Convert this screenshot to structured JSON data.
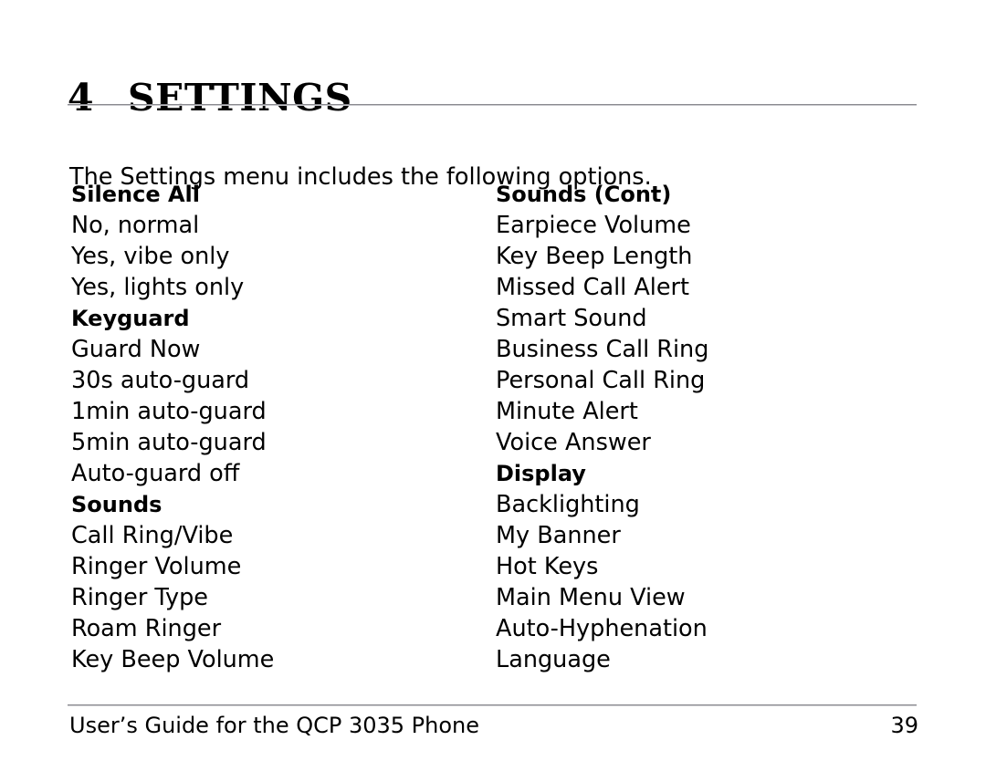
{
  "document": {
    "chapter_number": "4",
    "chapter_title": "SETTINGS",
    "intro": "The Settings menu includes the following options."
  },
  "columns": {
    "left": [
      {
        "text": "Silence All",
        "style": "heading"
      },
      {
        "text": "No, normal",
        "style": "item"
      },
      {
        "text": "Yes, vibe only",
        "style": "item"
      },
      {
        "text": "Yes, lights only",
        "style": "item"
      },
      {
        "text": "Keyguard",
        "style": "heading"
      },
      {
        "text": "Guard Now",
        "style": "item"
      },
      {
        "text": "30s auto-guard",
        "style": "item"
      },
      {
        "text": "1min auto-guard",
        "style": "item"
      },
      {
        "text": "5min auto-guard",
        "style": "item"
      },
      {
        "text": "Auto-guard off",
        "style": "item"
      },
      {
        "text": "Sounds",
        "style": "heading"
      },
      {
        "text": "Call Ring/Vibe",
        "style": "item"
      },
      {
        "text": "Ringer Volume",
        "style": "item"
      },
      {
        "text": "Ringer Type",
        "style": "item"
      },
      {
        "text": "Roam Ringer",
        "style": "item"
      },
      {
        "text": "Key Beep Volume",
        "style": "item"
      }
    ],
    "right": [
      {
        "text": "Sounds (Cont)",
        "style": "heading"
      },
      {
        "text": "Earpiece Volume",
        "style": "item"
      },
      {
        "text": "Key Beep Length",
        "style": "item"
      },
      {
        "text": "Missed Call Alert",
        "style": "item"
      },
      {
        "text": "Smart Sound",
        "style": "item"
      },
      {
        "text": "Business Call Ring",
        "style": "item"
      },
      {
        "text": "Personal Call Ring",
        "style": "item"
      },
      {
        "text": "Minute Alert",
        "style": "item"
      },
      {
        "text": "Voice Answer",
        "style": "item"
      },
      {
        "text": "Display",
        "style": "heading"
      },
      {
        "text": "Backlighting",
        "style": "item"
      },
      {
        "text": "My Banner",
        "style": "item"
      },
      {
        "text": "Hot Keys",
        "style": "item"
      },
      {
        "text": "Main Menu View",
        "style": "item"
      },
      {
        "text": "Auto-Hyphenation",
        "style": "item"
      },
      {
        "text": "Language",
        "style": "item"
      }
    ]
  },
  "footer": {
    "text": "User’s Guide for the QCP 3035 Phone",
    "page_number": "39"
  },
  "colors": {
    "text": "#000000",
    "background": "#ffffff",
    "rule": "#8a8a8f"
  }
}
